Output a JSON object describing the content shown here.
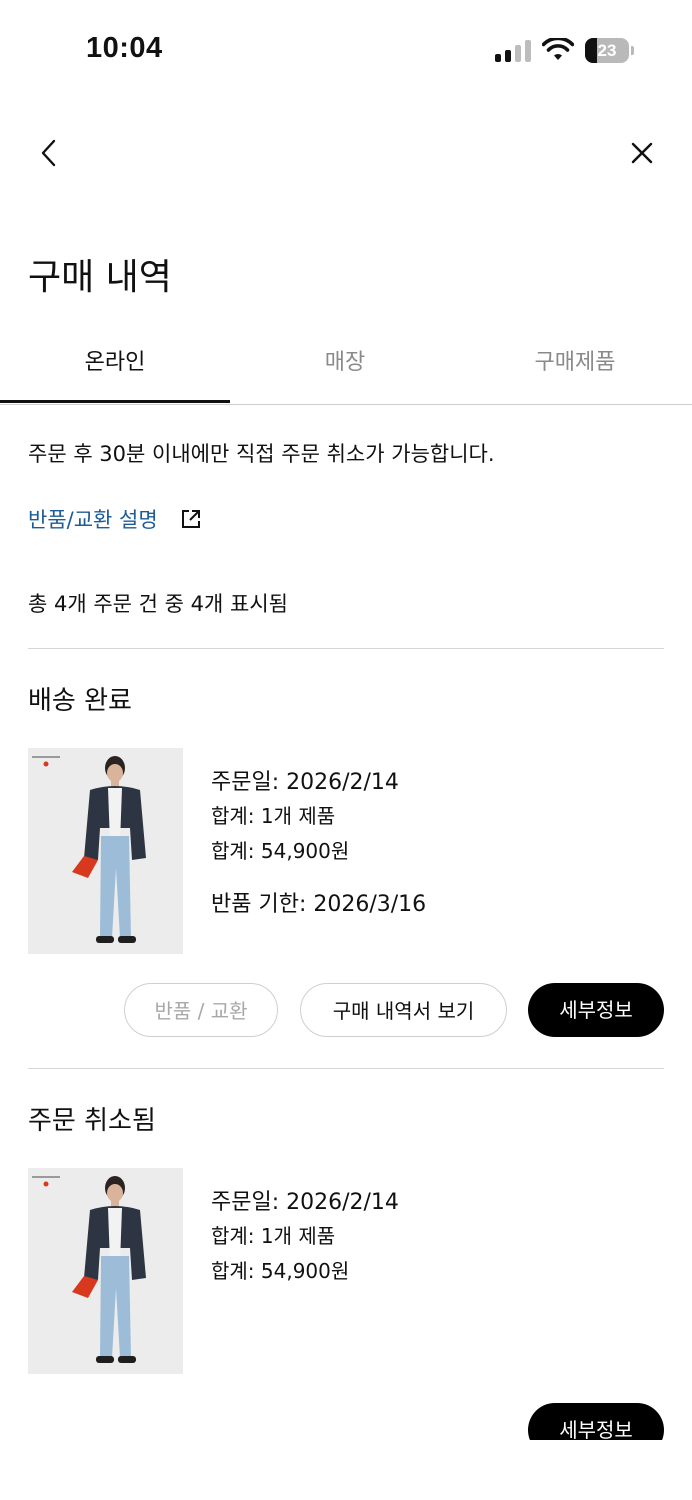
{
  "status_bar": {
    "time": "10:04",
    "battery": "23"
  },
  "nav": {
    "back_icon": "chevron-left-icon",
    "close_icon": "close-icon"
  },
  "page": {
    "title": "구매 내역"
  },
  "tabs": [
    {
      "label": "온라인",
      "active": true
    },
    {
      "label": "매장",
      "active": false
    },
    {
      "label": "구매제품",
      "active": false
    }
  ],
  "notice": "주문 후 30분 이내에만 직접 주문 취소가 가능합니다.",
  "return_link": {
    "label": "반품/교환 설명",
    "icon": "external-link-icon"
  },
  "order_count": "총 4개 주문 건 중 4개 표시됨",
  "orders": [
    {
      "status": "배송 완료",
      "order_date": "주문일: 2026/2/14",
      "item_count": "합계: 1개 제품",
      "total": "합계: 54,900원",
      "return_deadline": "반품 기한: 2026/3/16",
      "buttons": {
        "return_exchange": "반품 / 교환",
        "receipt": "구매 내역서 보기",
        "details": "세부정보"
      }
    },
    {
      "status": "주문 취소됨",
      "order_date": "주문일: 2026/2/14",
      "item_count": "합계: 1개 제품",
      "total": "합계: 54,900원",
      "buttons": {
        "details": "세부정보"
      }
    }
  ],
  "colors": {
    "link": "#1d5c96",
    "primary_button": "#000000",
    "divider": "#d6d6d6"
  }
}
